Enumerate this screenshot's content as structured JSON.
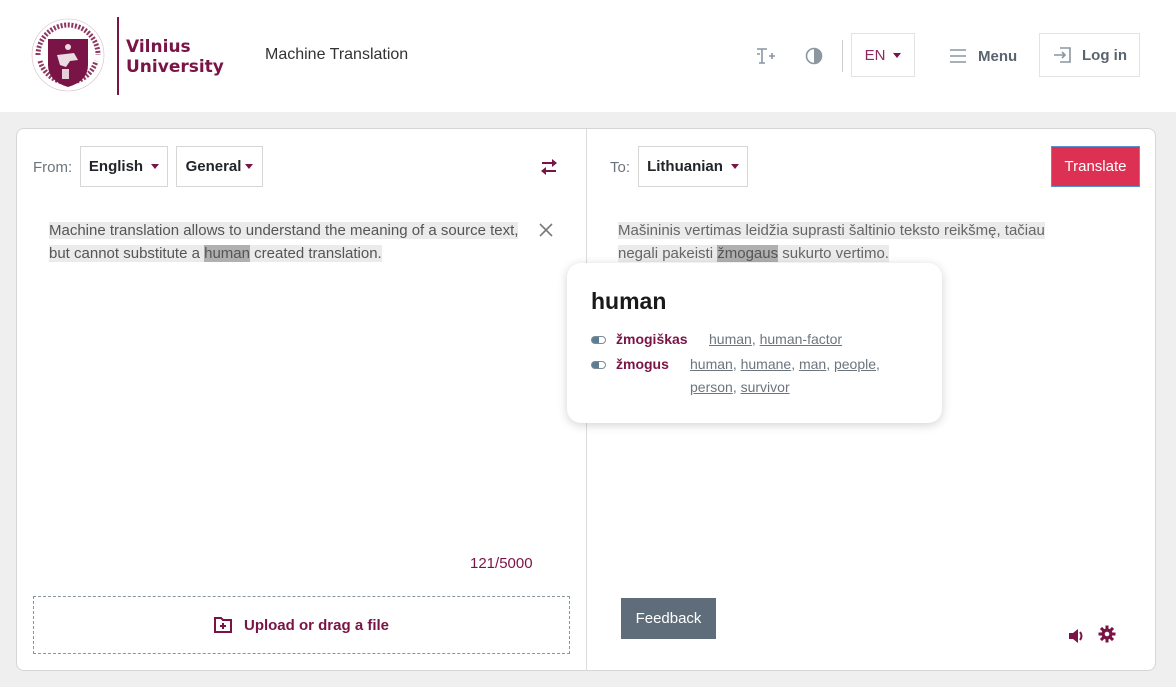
{
  "header": {
    "university_name_line1": "Vilnius",
    "university_name_line2": "University",
    "app_title": "Machine Translation",
    "language": "EN",
    "menu_label": "Menu",
    "login_label": "Log in",
    "icons": [
      "text-size-icon",
      "contrast-icon",
      "hamburger-icon",
      "login-icon"
    ]
  },
  "source": {
    "from_label": "From:",
    "language": "English",
    "domain": "General",
    "text_before": "Machine translation allows to understand the meaning of a source text, but cannot substitute a ",
    "text_highlight": "human",
    "text_after": " created translation.",
    "char_count": "121/5000",
    "upload_label": "Upload or drag a file"
  },
  "target": {
    "to_label": "To:",
    "language": "Lithuanian",
    "translate_label": "Translate",
    "text_before": "Mašininis vertimas leidžia suprasti šaltinio teksto reikšmę, tačiau negali pakeisti ",
    "text_highlight": "žmogaus",
    "text_after": " sukurto vertimo.",
    "feedback_label": "Feedback"
  },
  "dictionary_popup": {
    "word": "human",
    "entries": [
      {
        "term": "žmogiškas",
        "synonyms": [
          "human",
          "human-factor"
        ]
      },
      {
        "term": "žmogus",
        "synonyms": [
          "human",
          "humane",
          "man",
          "people",
          "person",
          "survivor"
        ]
      }
    ]
  },
  "colors": {
    "brand": "#7a1446",
    "translate_button": "#dc3152",
    "feedback_button": "#5f6d7a"
  }
}
